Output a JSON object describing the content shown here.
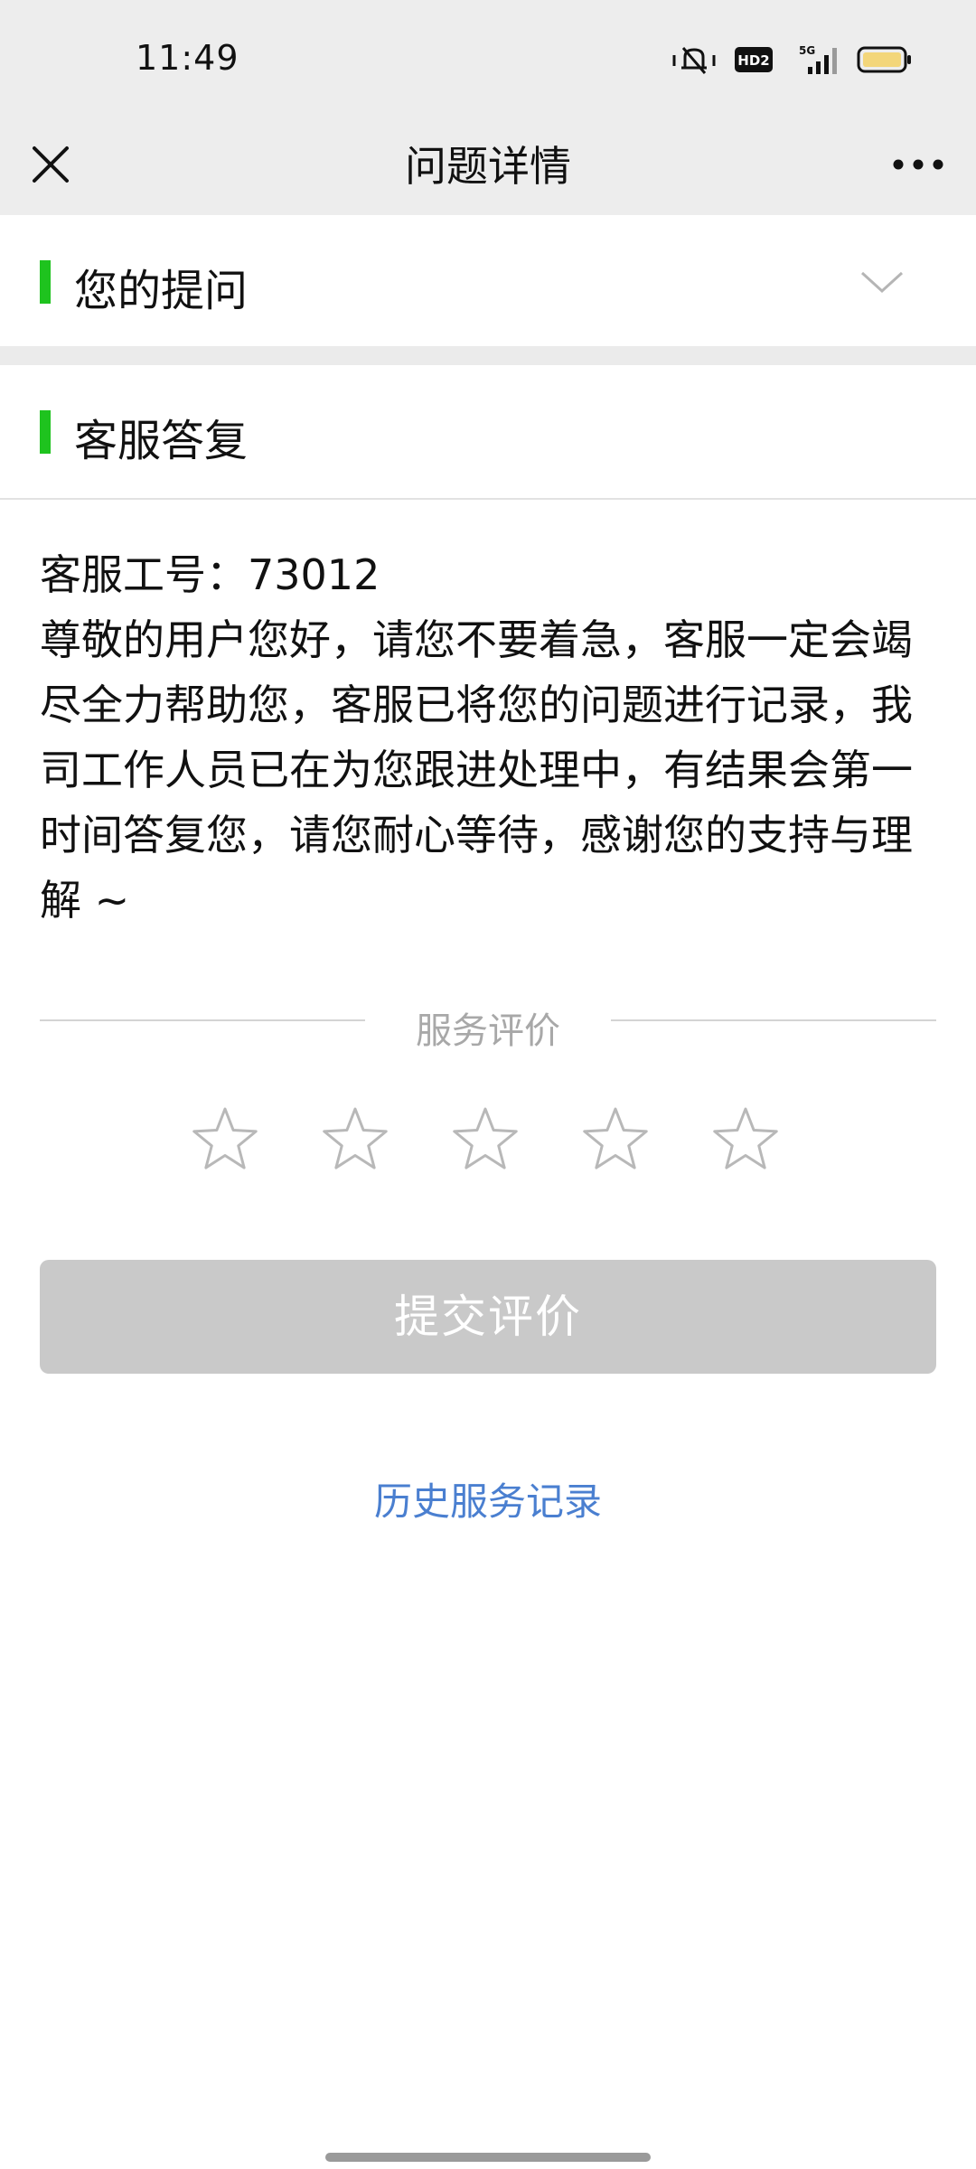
{
  "status_bar": {
    "time": "11:49",
    "icons": [
      "vibrate-icon",
      "hd-icon",
      "5g-signal-icon",
      "battery-icon"
    ],
    "hd_label": "HD2",
    "network_label": "5G"
  },
  "nav": {
    "title": "问题详情",
    "close_icon": "close-icon",
    "more_icon": "more-icon"
  },
  "question_section": {
    "title": "您的提问",
    "expand_icon": "chevron-down-icon"
  },
  "answer_section": {
    "title": "客服答复",
    "staff_line": "客服工号：73012",
    "message": "尊敬的用户您好，请您不要着急，客服一定会竭尽全力帮助您，客服已将您的问题进行记录，我司工作人员已在为您跟进处理中，有结果会第一时间答复您，请您耐心等待，感谢您的支持与理解 ~"
  },
  "rating": {
    "title": "服务评价",
    "max_stars": 5,
    "selected_stars": 0,
    "submit_label": "提交评价"
  },
  "history_link": "历史服务记录",
  "colors": {
    "accent_green": "#1ec31e",
    "link_blue": "#4a7fd0",
    "disabled_button": "#c9c9c9",
    "header_background": "#ededed"
  }
}
